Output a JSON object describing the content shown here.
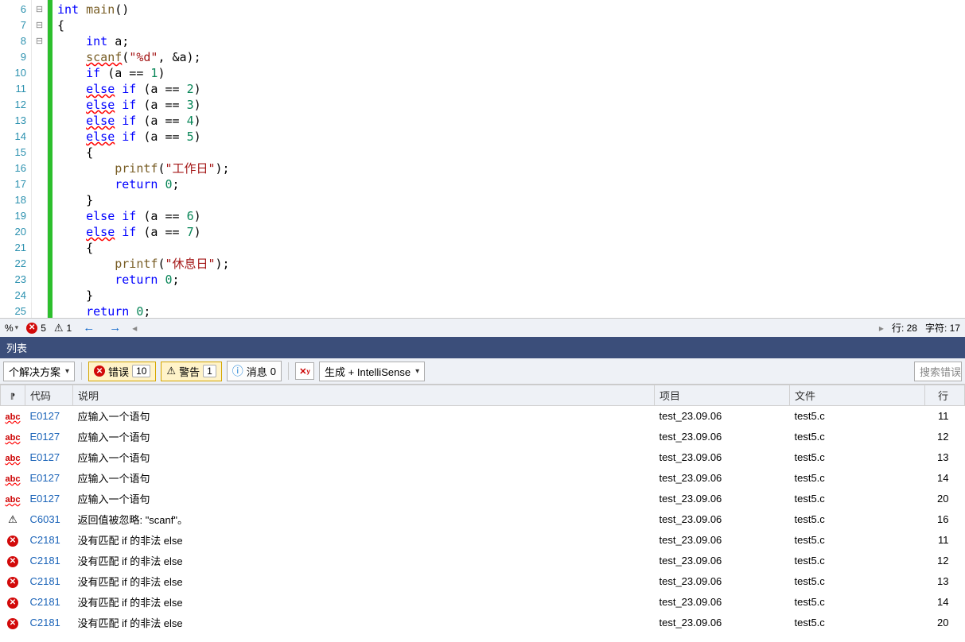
{
  "editor": {
    "lines": [
      {
        "ln": 6,
        "fold": "⊟",
        "tokens": [
          {
            "t": "int ",
            "c": "kw"
          },
          {
            "t": "main",
            "c": "fn"
          },
          {
            "t": "()"
          }
        ]
      },
      {
        "ln": 7,
        "tokens": [
          {
            "t": "{",
            "c": "id"
          }
        ]
      },
      {
        "ln": 8,
        "tokens": [
          {
            "t": "    "
          },
          {
            "t": "int ",
            "c": "kw"
          },
          {
            "t": "a;",
            "c": "id"
          }
        ]
      },
      {
        "ln": 9,
        "tokens": [
          {
            "t": "    "
          },
          {
            "t": "scanf",
            "c": "fn squig"
          },
          {
            "t": "("
          },
          {
            "t": "\"%d\"",
            "c": "str"
          },
          {
            "t": ", &a);"
          }
        ]
      },
      {
        "ln": 10,
        "tokens": [
          {
            "t": "    "
          },
          {
            "t": "if",
            "c": "kw"
          },
          {
            "t": " (a == "
          },
          {
            "t": "1",
            "c": "num"
          },
          {
            "t": ")"
          }
        ]
      },
      {
        "ln": 11,
        "tokens": [
          {
            "t": "    "
          },
          {
            "t": "else",
            "c": "kw squig"
          },
          {
            "t": " "
          },
          {
            "t": "if",
            "c": "kw"
          },
          {
            "t": " (a == "
          },
          {
            "t": "2",
            "c": "num"
          },
          {
            "t": ")"
          }
        ]
      },
      {
        "ln": 12,
        "tokens": [
          {
            "t": "    "
          },
          {
            "t": "else",
            "c": "kw squig"
          },
          {
            "t": " "
          },
          {
            "t": "if",
            "c": "kw"
          },
          {
            "t": " (a == "
          },
          {
            "t": "3",
            "c": "num"
          },
          {
            "t": ")"
          }
        ]
      },
      {
        "ln": 13,
        "tokens": [
          {
            "t": "    "
          },
          {
            "t": "else",
            "c": "kw squig"
          },
          {
            "t": " "
          },
          {
            "t": "if",
            "c": "kw"
          },
          {
            "t": " (a == "
          },
          {
            "t": "4",
            "c": "num"
          },
          {
            "t": ")"
          }
        ]
      },
      {
        "ln": 14,
        "fold": "⊟",
        "tokens": [
          {
            "t": "    "
          },
          {
            "t": "else",
            "c": "kw squig"
          },
          {
            "t": " "
          },
          {
            "t": "if",
            "c": "kw"
          },
          {
            "t": " (a == "
          },
          {
            "t": "5",
            "c": "num"
          },
          {
            "t": ")"
          }
        ]
      },
      {
        "ln": 15,
        "tokens": [
          {
            "t": "    {"
          }
        ]
      },
      {
        "ln": 16,
        "tokens": [
          {
            "t": "        "
          },
          {
            "t": "printf",
            "c": "fn"
          },
          {
            "t": "("
          },
          {
            "t": "\"工作日\"",
            "c": "str"
          },
          {
            "t": ");"
          }
        ]
      },
      {
        "ln": 17,
        "tokens": [
          {
            "t": "        "
          },
          {
            "t": "return",
            "c": "kw"
          },
          {
            "t": " "
          },
          {
            "t": "0",
            "c": "num"
          },
          {
            "t": ";"
          }
        ]
      },
      {
        "ln": 18,
        "tokens": [
          {
            "t": "    }"
          }
        ]
      },
      {
        "ln": 19,
        "tokens": [
          {
            "t": "    "
          },
          {
            "t": "else",
            "c": "kw"
          },
          {
            "t": " "
          },
          {
            "t": "if",
            "c": "kw"
          },
          {
            "t": " (a == "
          },
          {
            "t": "6",
            "c": "num"
          },
          {
            "t": ")"
          }
        ]
      },
      {
        "ln": 20,
        "fold": "⊟",
        "tokens": [
          {
            "t": "    "
          },
          {
            "t": "else",
            "c": "kw squig"
          },
          {
            "t": " "
          },
          {
            "t": "if",
            "c": "kw"
          },
          {
            "t": " (a == "
          },
          {
            "t": "7",
            "c": "num"
          },
          {
            "t": ")"
          }
        ]
      },
      {
        "ln": 21,
        "tokens": [
          {
            "t": "    {"
          }
        ]
      },
      {
        "ln": 22,
        "tokens": [
          {
            "t": "        "
          },
          {
            "t": "printf",
            "c": "fn"
          },
          {
            "t": "("
          },
          {
            "t": "\"休息日\"",
            "c": "str"
          },
          {
            "t": ");"
          }
        ]
      },
      {
        "ln": 23,
        "tokens": [
          {
            "t": "        "
          },
          {
            "t": "return",
            "c": "kw"
          },
          {
            "t": " "
          },
          {
            "t": "0",
            "c": "num"
          },
          {
            "t": ";"
          }
        ]
      },
      {
        "ln": 24,
        "tokens": [
          {
            "t": "    }"
          }
        ]
      },
      {
        "ln": 25,
        "tokens": [
          {
            "t": "    "
          },
          {
            "t": "return",
            "c": "kw"
          },
          {
            "t": " "
          },
          {
            "t": "0",
            "c": "num"
          },
          {
            "t": ";"
          }
        ]
      }
    ]
  },
  "status": {
    "zoom": "%",
    "err_count": "5",
    "warn_count": "1",
    "line_label": "行: 28",
    "char_label": "字符: 17"
  },
  "panel": {
    "title": "列表"
  },
  "filter": {
    "scope": "个解决方案",
    "errors_label": "错误",
    "errors_count": "10",
    "warnings_label": "警告",
    "warnings_count": "1",
    "messages_label": "消息",
    "messages_count": "0",
    "source": "生成 + IntelliSense",
    "search_placeholder": "搜索错误"
  },
  "table": {
    "cols": {
      "icon": "",
      "code": "代码",
      "desc": "说明",
      "proj": "项目",
      "file": "文件",
      "line": "行"
    },
    "rows": [
      {
        "icon": "abc",
        "code": "E0127",
        "desc": "应输入一个语句",
        "proj": "test_23.09.06",
        "file": "test5.c",
        "line": "11"
      },
      {
        "icon": "abc",
        "code": "E0127",
        "desc": "应输入一个语句",
        "proj": "test_23.09.06",
        "file": "test5.c",
        "line": "12"
      },
      {
        "icon": "abc",
        "code": "E0127",
        "desc": "应输入一个语句",
        "proj": "test_23.09.06",
        "file": "test5.c",
        "line": "13"
      },
      {
        "icon": "abc",
        "code": "E0127",
        "desc": "应输入一个语句",
        "proj": "test_23.09.06",
        "file": "test5.c",
        "line": "14"
      },
      {
        "icon": "abc",
        "code": "E0127",
        "desc": "应输入一个语句",
        "proj": "test_23.09.06",
        "file": "test5.c",
        "line": "20"
      },
      {
        "icon": "warn",
        "code": "C6031",
        "desc": "返回值被忽略: \"scanf\"。",
        "proj": "test_23.09.06",
        "file": "test5.c",
        "line": "16"
      },
      {
        "icon": "err",
        "code": "C2181",
        "desc": "没有匹配 if 的非法 else",
        "proj": "test_23.09.06",
        "file": "test5.c",
        "line": "11"
      },
      {
        "icon": "err",
        "code": "C2181",
        "desc": "没有匹配 if 的非法 else",
        "proj": "test_23.09.06",
        "file": "test5.c",
        "line": "12"
      },
      {
        "icon": "err",
        "code": "C2181",
        "desc": "没有匹配 if 的非法 else",
        "proj": "test_23.09.06",
        "file": "test5.c",
        "line": "13"
      },
      {
        "icon": "err",
        "code": "C2181",
        "desc": "没有匹配 if 的非法 else",
        "proj": "test_23.09.06",
        "file": "test5.c",
        "line": "14"
      },
      {
        "icon": "err",
        "code": "C2181",
        "desc": "没有匹配 if 的非法 else",
        "proj": "test_23.09.06",
        "file": "test5.c",
        "line": "20"
      }
    ]
  }
}
